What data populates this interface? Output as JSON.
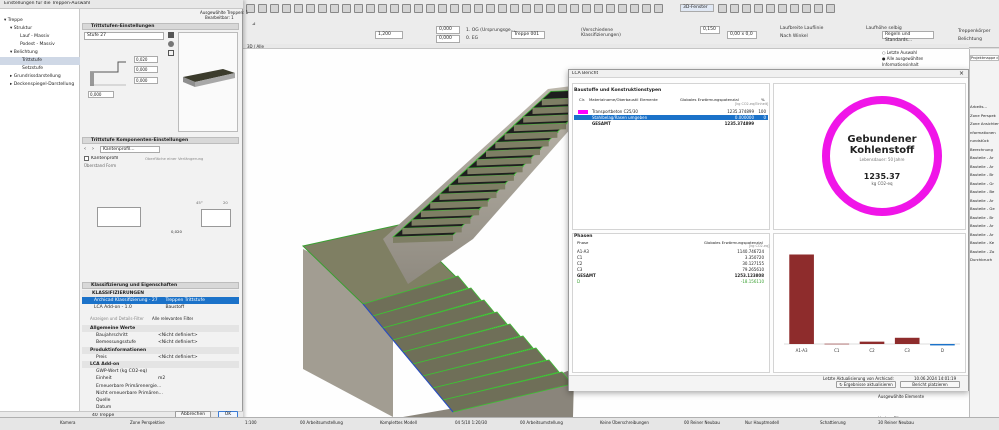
{
  "dialog": {
    "title": "Einstellungen für die Treppen-Auswahl",
    "selection_summary": "Ausgewählte Treppen: 1",
    "selection_editable": "Bearbeitbar: 1",
    "tree": [
      {
        "label": "Treppe",
        "level": 0
      },
      {
        "label": "Struktur",
        "level": 1
      },
      {
        "label": "Lauf - Massiv",
        "level": 2
      },
      {
        "label": "Podest - Massiv",
        "level": 2
      },
      {
        "label": "Belichtung",
        "level": 1
      },
      {
        "label": "Trittstufe",
        "level": 2,
        "selected": true
      },
      {
        "label": "Setzstufe",
        "level": 2
      },
      {
        "label": "Grundrissdarstellung",
        "level": 1
      },
      {
        "label": "Deckenspiegel-Darstellung",
        "level": 1
      }
    ],
    "tread_settings": {
      "header": "Trittstufen-Einstellungen",
      "stair_select": "Stufe 27",
      "value_1": "0,020",
      "value_2": "0,000",
      "value_3": "0,000",
      "value_4": "0,000"
    },
    "components": {
      "header": "Trittstufe Komponenten-Einstellungen",
      "profile_select": "Kantenprofil...",
      "edge_profile_checkbox": "Kantenprofil",
      "edge_profile_label": "Überstand Form",
      "extra_label": "Oberfläche einer Verlängerung",
      "angle": "45°",
      "size": "0,020",
      "size2": "20"
    },
    "classification": {
      "header": "Klassifizierung und Eigenschaften",
      "subheader": "KLASSIFIZIERUNGEN",
      "rows": [
        {
          "label": "Archicad Klassifizierung - 27",
          "value": "Treppen Trittstufe",
          "selected": true
        },
        {
          "label": "LCA Add-on - 1.0",
          "value": "Baustoff"
        }
      ],
      "filter_placeholder": "Anzeigen und Details-Filter",
      "filter_value": "Alle relevanten Filter",
      "properties": [
        {
          "label": "Allgemeine Werte",
          "head": true
        },
        {
          "label": "Baujahrschritt",
          "value": "<Nicht definiert>"
        },
        {
          "label": "Bemessungsstufe",
          "value": "<Nicht definiert>"
        },
        {
          "label": "Produktinformationen",
          "head": true
        },
        {
          "label": "Preis",
          "value": "<Nicht definiert>"
        },
        {
          "label": "LCA Add-on",
          "head": true
        },
        {
          "label": "GWP-Wert (kg CO2-eq)",
          "value": ""
        },
        {
          "label": "Einheit",
          "value": "m2"
        },
        {
          "label": "Erneuerbare Primärenergie...",
          "value": ""
        },
        {
          "label": "Nicht erneuerbare Primären...",
          "value": ""
        },
        {
          "label": "Quelle",
          "value": ""
        },
        {
          "label": "Datum",
          "value": ""
        }
      ]
    },
    "footer": {
      "layer": "40 Treppe",
      "cancel": "Abbrechen",
      "ok": "OK"
    }
  },
  "toolbar": {
    "view_mode": "3D-Fenster",
    "field_a": "1,200",
    "field_b": "0,000",
    "field_c": "0,000",
    "stair_name": "Treppe 001",
    "field_d": "0,00 x 0,0",
    "field_e": "0,150",
    "label_1": "1. OG (Ursprungsge...",
    "label_2": "0. EG",
    "label_3": "(Verschiedene Klassifizierungen)",
    "label_4": "Laufbreite Lauflinie",
    "label_5": "Nach Winkel",
    "rules_btn": "Regeln und Standards...",
    "check_treppen": "Treppenkörper",
    "check_bel": "Belichtung",
    "stepping": "Laufhöhe selbig",
    "tab_3d": "3D / Alle",
    "tab_center": "Kamera - Center"
  },
  "lca": {
    "title": "LCA Bericht",
    "materials_header": "Baustoffe und Konstruktionstypen",
    "col_color": "Clr.",
    "col_material": "Materialname/Oberbaustil Elemente",
    "col_gwp": "Globales Erwärmungspotenzial",
    "col_unit": "[kg CO2-eq/Einheit]",
    "col_pct": "%",
    "materials": [
      {
        "color": "#ff00ff",
        "name": "Transportbeton C25/30",
        "value": "1235.374899",
        "pct": "100"
      },
      {
        "color": "#1b72c9",
        "name": "Stahlbelag/Rasen umgeben",
        "value": "0.000000",
        "pct": "0",
        "selected": true
      }
    ],
    "materials_total_label": "GESAMT",
    "materials_total": "1235.374899",
    "phases_header": "Phasen",
    "phase_col": "Phase",
    "phase_gwp": "Globales Erwärmungspotenzial",
    "phase_unit": "[kg CO2-eq]",
    "phases": [
      {
        "name": "A1-A3",
        "value": "1140.746724"
      },
      {
        "name": "C1",
        "value": "3.350720"
      },
      {
        "name": "C2",
        "value": "30.127155"
      },
      {
        "name": "C3",
        "value": "79.265610"
      },
      {
        "name": "GESAMT",
        "value": "1253.123808",
        "bold": true
      },
      {
        "name": "D",
        "value": "-18.156110",
        "neg": true
      }
    ],
    "ring_title_1": "Gebundener",
    "ring_title_2": "Kohlenstoff",
    "ring_sub": "Lebensdauer: 50 Jahre",
    "ring_value": "1235.37",
    "ring_unit": "kg CO2-eq",
    "ring_color": "#f015e8",
    "bar_color": "#8e2c2c",
    "last_update_label": "Letzte Aktualisierung von Archicad:",
    "last_update": "10.06.2024 14:01:19",
    "btn_results": "Ergebnisse aktualisieren",
    "btn_report": "Bericht platzieren"
  },
  "chart_data": {
    "type": "bar",
    "categories": [
      "A1-A3",
      "C1",
      "C2",
      "C3",
      "D"
    ],
    "values": [
      1140.746724,
      3.35072,
      30.127155,
      79.26561,
      -18.15611
    ],
    "ylim": [
      -50,
      1250
    ],
    "colors": [
      "#8e2c2c",
      "#8e2c2c",
      "#8e2c2c",
      "#8e2c2c",
      "#1b72c9"
    ]
  },
  "right_panel": {
    "last_selection": "Letzte Auswahl",
    "all_selected": "Alle ausgewählten",
    "info_label": "Informationsinhalt",
    "search": "Projektmappe durchsu...",
    "items": [
      "Arbeits...",
      "Zone Perspek",
      "Zone Ansichten",
      "nformationen",
      "rundstück",
      "Berechnung",
      "Bauteile - Ar",
      "Bauteile - Ar",
      "Bauteile - Br",
      "Bauteile - Gr",
      "Bauteile - Be",
      "Bauteile - Ar",
      "Bauteile - Ge",
      "Bauteile - Br",
      "Bauteile - Ar",
      "Bauteile - Ar",
      "Bauteile - Ke",
      "Bauteile - Zo",
      "Durchbruch"
    ],
    "selected_elements": "Ausgewählte Elemente",
    "filter": "Umbau-Filter",
    "filter_value": "30 Reiner Neubau"
  },
  "status": {
    "items": [
      "Kamera",
      "Zone Perspektive",
      "1:100",
      "00 Arbeitsumstellung",
      "Komplettes Modell",
      "04 5/10 1:20/30",
      "00 Arbeitsumstellung",
      "Keine Überschreibungen",
      "00 Reiner Neubau",
      "Nur Hauptmodell",
      "Schattierung",
      "30 Reiner Neubau"
    ]
  }
}
